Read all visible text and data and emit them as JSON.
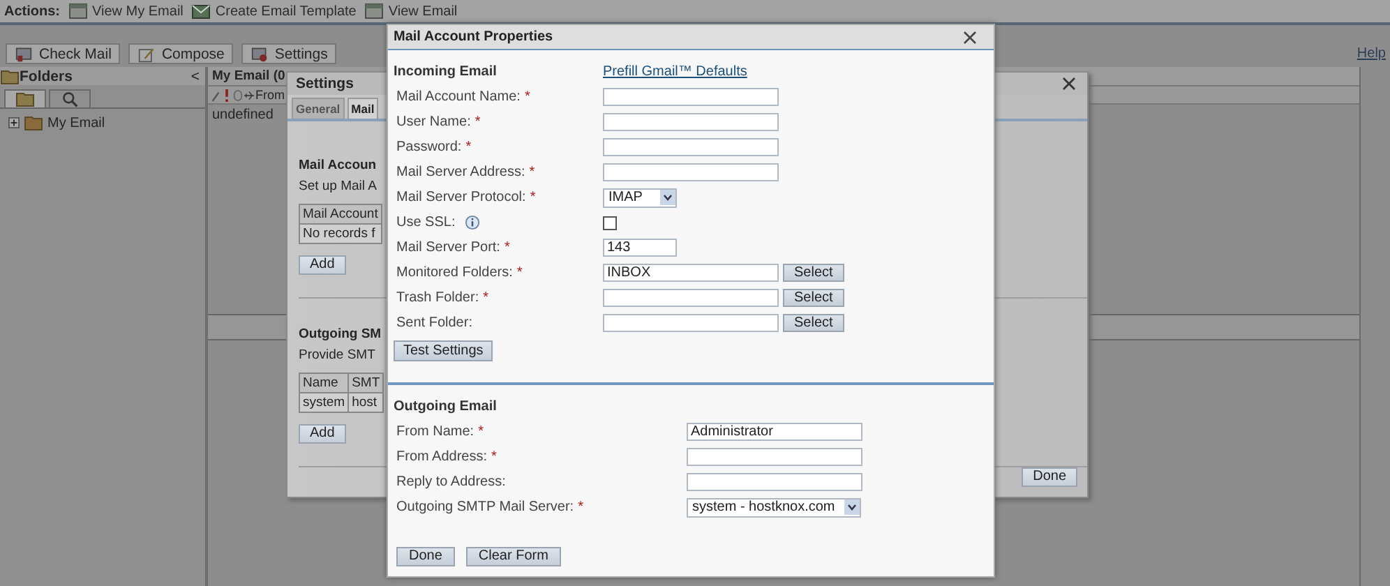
{
  "actions_bar": {
    "label": "Actions:",
    "items": [
      {
        "kind": "window",
        "label": "View My Email"
      },
      {
        "kind": "template",
        "label": "Create Email Template"
      },
      {
        "kind": "window",
        "label": "View Email"
      }
    ]
  },
  "toolbar": {
    "buttons": [
      {
        "kind": "check",
        "label": "Check Mail"
      },
      {
        "kind": "compose",
        "label": "Compose"
      },
      {
        "kind": "settings",
        "label": "Settings"
      }
    ],
    "help": "Help"
  },
  "folders_panel": {
    "title": "Folders",
    "collapse": "<",
    "tabs": [
      {
        "kind": "folders",
        "selected": true
      },
      {
        "kind": "search",
        "selected": false
      }
    ],
    "tree": [
      {
        "label": "My Email",
        "expanded": false
      }
    ]
  },
  "mail_list": {
    "title": "My Email (0",
    "columns": [
      "From"
    ],
    "rows": [
      "undefined"
    ]
  },
  "settings_dialog": {
    "title": "Settings",
    "tabs": [
      {
        "label": "General",
        "selected": false
      },
      {
        "label": "Mail",
        "selected": true
      }
    ],
    "mail_accounts": {
      "heading": "Mail Accoun",
      "description": "Set up Mail A",
      "columns": [
        "Mail Account"
      ],
      "rows": [
        [
          "No records f"
        ]
      ],
      "add": "Add"
    },
    "smtp_servers": {
      "heading": "Outgoing SM",
      "description": "Provide SMT",
      "columns": [
        "Name",
        "SMT"
      ],
      "rows": [
        [
          "system",
          "host"
        ]
      ],
      "add": "Add"
    },
    "done": "Done"
  },
  "mail_account_dialog": {
    "title": "Mail Account Properties",
    "incoming": {
      "heading": "Incoming Email",
      "prefill_link": "Prefill Gmail™ Defaults",
      "fields": [
        {
          "kind": "text",
          "label": "Mail Account Name:",
          "marker": "*"
        },
        {
          "kind": "text",
          "label": "User Name:",
          "marker": "*"
        },
        {
          "kind": "text",
          "label": "Password:",
          "marker": "*"
        },
        {
          "kind": "text",
          "label": "Mail Server Address:",
          "marker": "*"
        },
        {
          "kind": "select",
          "label": "Mail Server Protocol:",
          "marker": "*",
          "value": "IMAP"
        },
        {
          "kind": "checkbox",
          "label": "Use SSL:",
          "info": true,
          "checked": false
        },
        {
          "kind": "short_text",
          "label": "Mail Server Port:",
          "marker": "*",
          "value": "143"
        },
        {
          "kind": "picker",
          "label": "Monitored Folders:",
          "marker": "*",
          "value": "INBOX",
          "button": "Select"
        },
        {
          "kind": "picker",
          "label": "Trash Folder:",
          "marker": "*",
          "button": "Select"
        },
        {
          "kind": "picker",
          "label": "Sent Folder:",
          "button": "Select"
        }
      ],
      "test_button": "Test Settings"
    },
    "outgoing": {
      "heading": "Outgoing Email",
      "fields": [
        {
          "kind": "text",
          "label": "From Name:",
          "marker": "*",
          "value": "Administrator"
        },
        {
          "kind": "text",
          "label": "From Address:",
          "marker": "*"
        },
        {
          "kind": "text",
          "label": "Reply to Address:"
        },
        {
          "kind": "select",
          "label": "Outgoing SMTP Mail Server:",
          "marker": "*",
          "value": "system - hostknox.com"
        }
      ]
    },
    "buttons": [
      "Done",
      "Clear Form"
    ]
  }
}
